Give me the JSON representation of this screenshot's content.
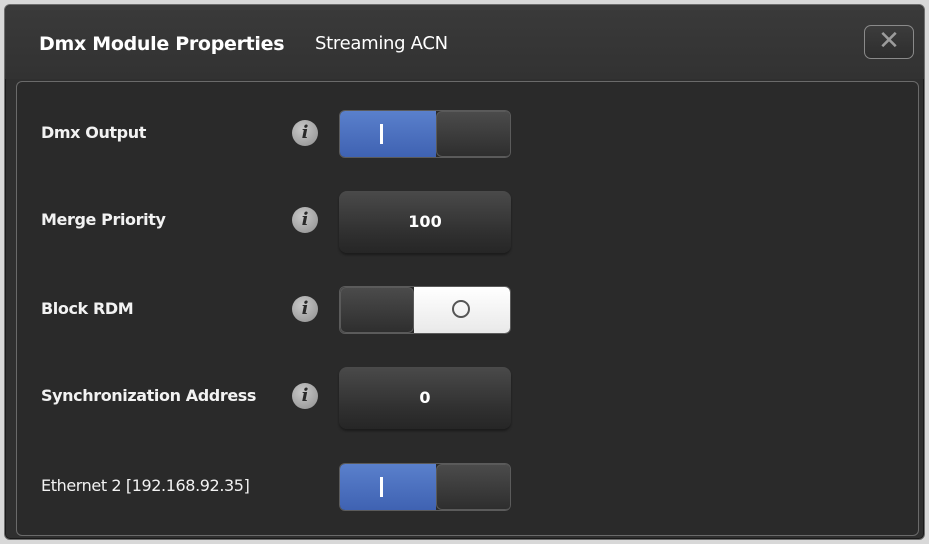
{
  "dialog": {
    "title": "Dmx Module Properties",
    "subtitle": "Streaming ACN",
    "close_icon": "close-icon"
  },
  "rows": [
    {
      "label": "Dmx Output",
      "control": "toggle",
      "state": "on",
      "info_icon": "info-icon"
    },
    {
      "label": "Merge Priority",
      "control": "value",
      "value": "100",
      "info_icon": "info-icon"
    },
    {
      "label": "Block RDM",
      "control": "toggle",
      "state": "off",
      "info_icon": "info-icon"
    },
    {
      "label": "Synchronization Address",
      "control": "value",
      "value": "0",
      "info_icon": "info-icon"
    },
    {
      "label": "Ethernet 2 [192.168.92.35]",
      "control": "toggle",
      "state": "on"
    }
  ],
  "colors": {
    "toggle_on": "#4a6fc0",
    "background": "#2f2f2f",
    "text": "#ffffff"
  }
}
